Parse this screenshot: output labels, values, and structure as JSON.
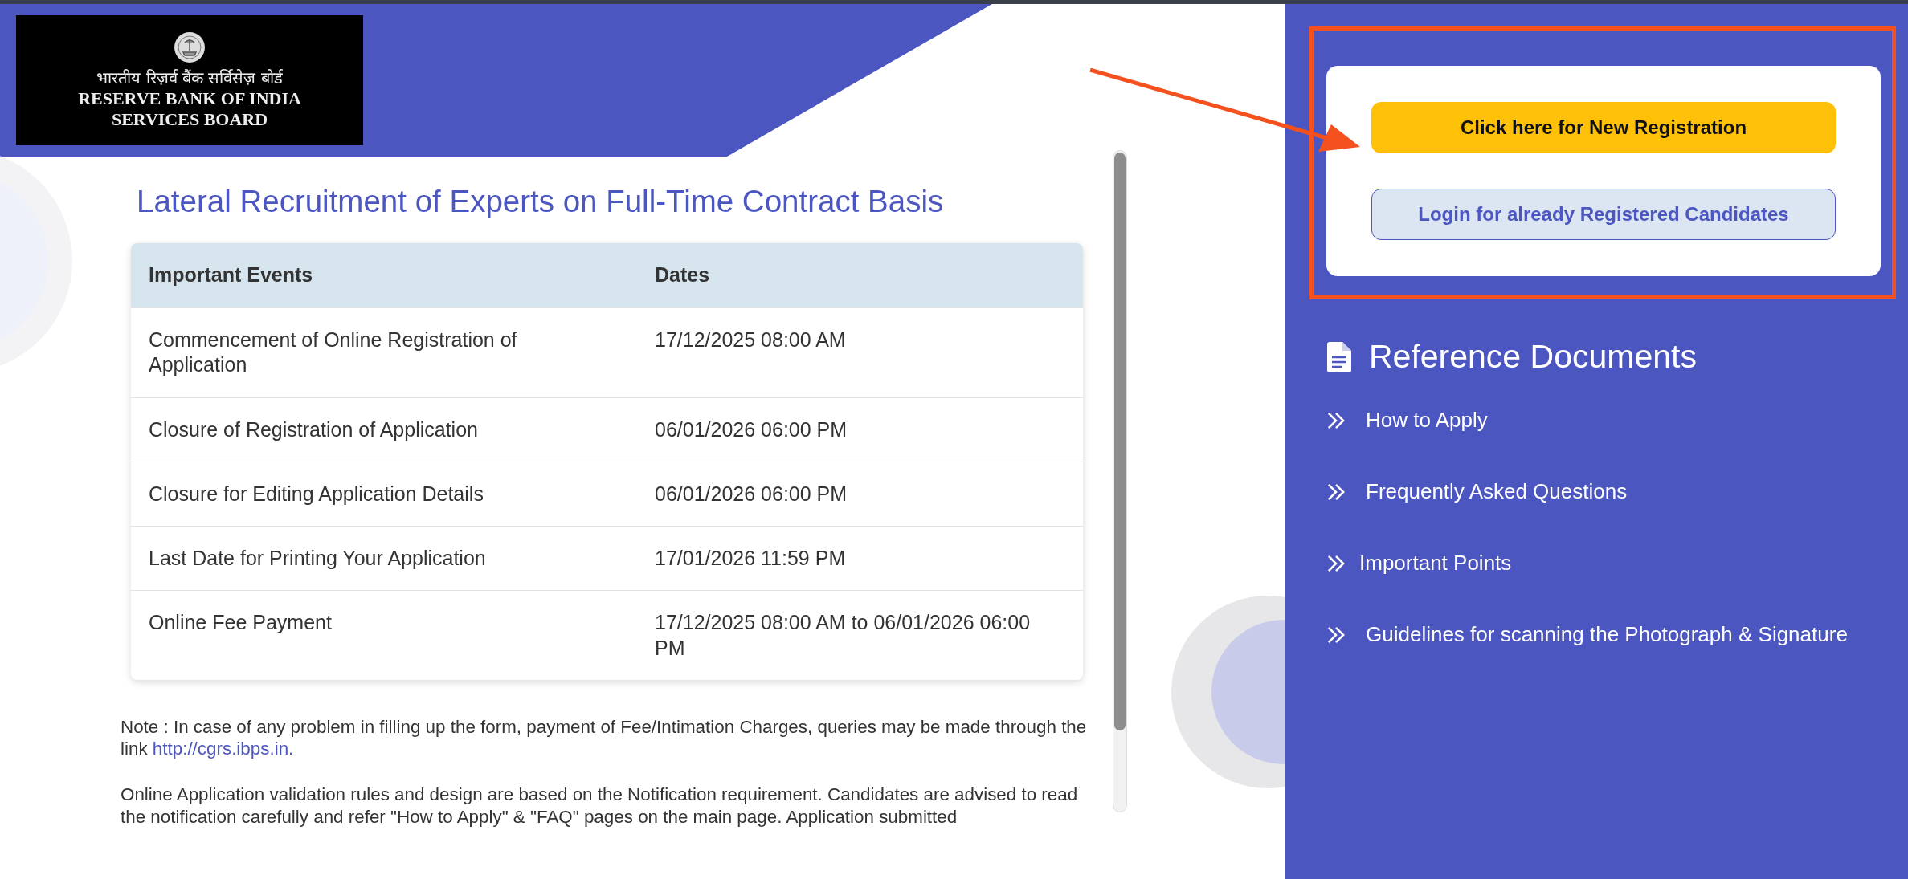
{
  "logo": {
    "hindi": "भारतीय रिज़र्व बैंक सर्विसेज़ बोर्ड",
    "lines": [
      "RESERVE BANK OF INDIA",
      "SERVICES BOARD"
    ]
  },
  "title": "Lateral Recruitment of Experts on Full-Time Contract Basis",
  "table": {
    "columns": [
      "Important Events",
      "Dates"
    ],
    "rows": [
      [
        "Commencement of Online Registration of Application",
        "17/12/2025 08:00 AM"
      ],
      [
        "Closure of Registration of Application",
        "06/01/2026 06:00 PM"
      ],
      [
        "Closure for Editing Application Details",
        "06/01/2026 06:00 PM"
      ],
      [
        "Last Date for Printing Your Application",
        "17/01/2026 11:59 PM"
      ],
      [
        "Online Fee Payment",
        "17/12/2025 08:00 AM to 06/01/2026 06:00 PM"
      ]
    ]
  },
  "notes": [
    {
      "text": "Note : In case of any problem in filling up the form, payment of Fee/Intimation Charges, queries may be made through the link ",
      "link": "http://cgrs.ibps.in."
    },
    {
      "text": "Online Application validation rules and design are based on the Notification requirement. Candidates are advised to read the notification carefully and refer \"How to Apply\" & \"FAQ\" pages on the main page. Application submitted"
    }
  ],
  "actions": [
    {
      "label": "Click here for New Registration",
      "kind": "primary"
    },
    {
      "label": "Login for already Registered Candidates",
      "kind": "secondary"
    }
  ],
  "reference": {
    "title": "Reference Documents",
    "items": [
      "How to Apply",
      "Frequently Asked Questions",
      "Important Points",
      "Guidelines for scanning the Photograph & Signature"
    ]
  }
}
